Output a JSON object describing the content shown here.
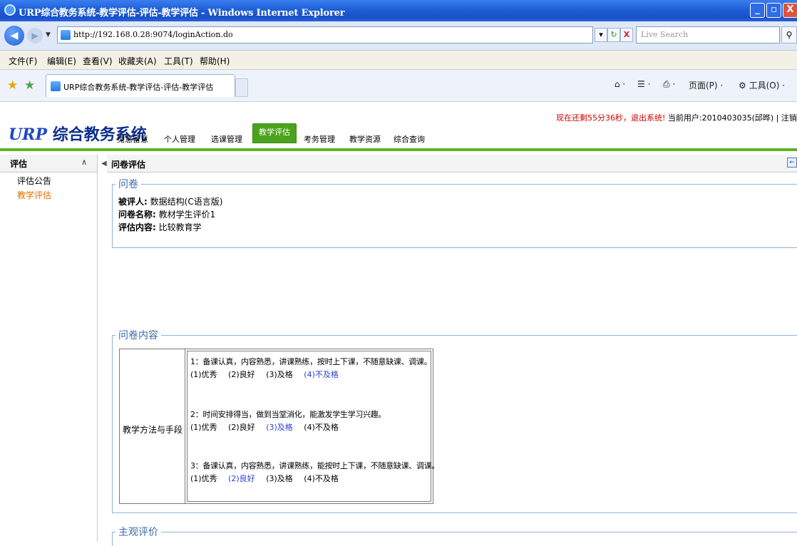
{
  "window": {
    "title": "URP综合教务系统-教学评估-评估-教学评估 - Windows Internet Explorer",
    "min_glyph": "_",
    "max_glyph": "▫",
    "close_glyph": "X"
  },
  "address": {
    "url": "http://192.168.0.28:9074/loginAction.do",
    "search_placeholder": "Live Search",
    "back_glyph": "◀",
    "forward_glyph": "▶",
    "dropdown_glyph": "▼",
    "url_dropdown_glyph": "▾",
    "refresh_glyph": "↻",
    "stop_glyph": "X",
    "search_glyph": "⚲"
  },
  "menu": [
    "文件(F)",
    "编辑(E)",
    "查看(V)",
    "收藏夹(A)",
    "工具(T)",
    "帮助(H)"
  ],
  "tabbar": {
    "tab_label": "URP综合教务系统-教学评估-评估-教学评估",
    "tools": {
      "home": "⌂ ·",
      "feeds": "☰ ·",
      "print": "⎙ ·",
      "page": "页面(P) ·",
      "tools": "⚙ 工具(O) ·"
    }
  },
  "app": {
    "logo_urp": "URP",
    "logo_rest": "综合教务系统",
    "status_red": "现在还剩55分36秒，退出系统!",
    "status_user": "当前用户:2010403035(邱晔) | 注销",
    "nav": [
      "觉慧留意",
      "个人管理",
      "选课管理",
      "教学评估",
      "考务管理",
      "教学资源",
      "综合查询"
    ],
    "active_nav": "教学评估"
  },
  "sidebar": {
    "title": "评估",
    "collapse_glyph": "∧",
    "items": [
      {
        "label": "评估公告",
        "color": "#000000"
      },
      {
        "label": "教学评估",
        "color": "#e07000"
      }
    ]
  },
  "main": {
    "collapse_glyph": "◀",
    "title": "问卷评估",
    "exit_glyph": "←",
    "questionnaire": {
      "legend": "问卷",
      "evaluatee_label": "被评人:",
      "evaluatee": "数据结构(C语言版)",
      "survey_label": "问卷名称:",
      "survey": "教材学生评价1",
      "content_label": "评估内容:",
      "content": "比较教育学"
    },
    "content_section": {
      "legend": "问卷内容",
      "category": "教学方法与手段",
      "questions": [
        {
          "text": "1：备课认真，内容熟悉，讲课熟练，按时上下课，不随意缺课、调课。",
          "options": [
            "(1)优秀",
            "(2)良好",
            "(3)及格",
            "(4)不及格"
          ],
          "selected": 3
        },
        {
          "text": "2：时间安排得当，做到当堂消化，能激发学生学习兴趣。",
          "options": [
            "(1)优秀",
            "(2)良好",
            "(3)及格",
            "(4)不及格"
          ],
          "selected": 2
        },
        {
          "text": "3：备课认真，内容熟悉，讲课熟练，能按时上下课，不随意缺课、调课。",
          "options": [
            "(1)优秀",
            "(2)良好",
            "(3)及格",
            "(4)不及格"
          ],
          "selected": 1
        }
      ]
    },
    "subjective": {
      "legend": "主观评价"
    }
  }
}
